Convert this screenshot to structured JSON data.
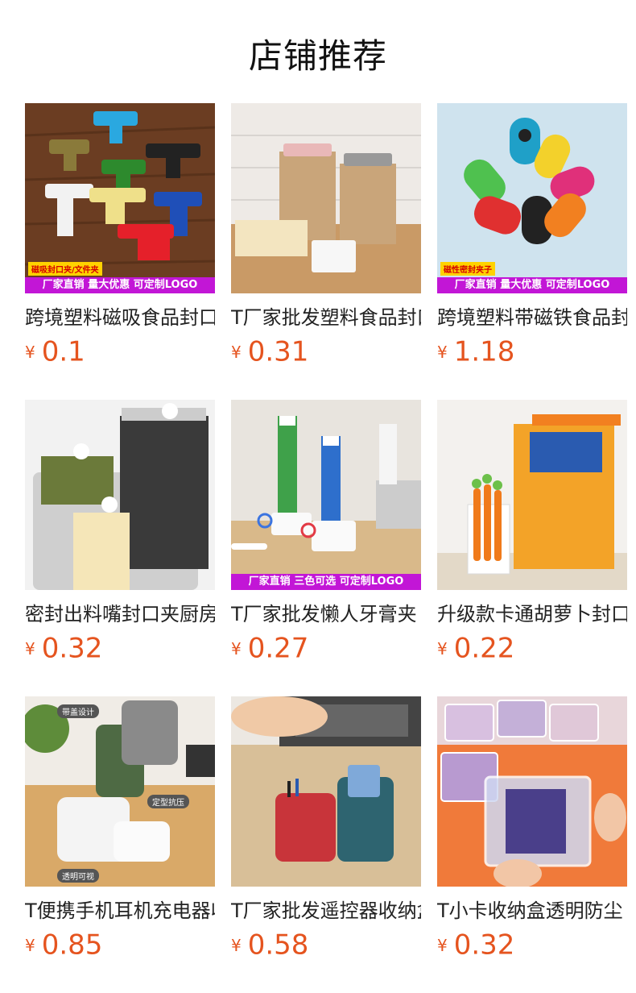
{
  "shop": {
    "title": "店铺推荐"
  },
  "currency": "¥",
  "products": [
    {
      "name": "跨境塑料磁吸食品封口夹",
      "price": "0.1",
      "banner": "厂家直销 量大优惠 可定制LOGO",
      "tag": "磁吸封口夹/文件夹"
    },
    {
      "name": "T厂家批发塑料食品封口夹",
      "price": "0.31",
      "banner": "",
      "tag": ""
    },
    {
      "name": "跨境塑料带磁铁食品封口夹",
      "price": "1.18",
      "banner": "厂家直销 量大优惠 可定制LOGO",
      "tag": "磁性密封夹子"
    },
    {
      "name": "密封出料嘴封口夹厨房",
      "price": "0.32",
      "banner": "",
      "tag": ""
    },
    {
      "name": "T厂家批发懒人牙膏夹",
      "price": "0.27",
      "banner": "厂家直销 三色可选 可定制LOGO",
      "tag": ""
    },
    {
      "name": "升级款卡通胡萝卜封口夹",
      "price": "0.22",
      "banner": "",
      "tag": ""
    },
    {
      "name": "T便携手机耳机充电器收纳盒",
      "price": "0.85",
      "banner": "",
      "tag": "",
      "labels": [
        "带盖设计",
        "定型抗压",
        "透明可视"
      ]
    },
    {
      "name": "T厂家批发遥控器收纳盒",
      "price": "0.58",
      "banner": "",
      "tag": ""
    },
    {
      "name": "T小卡收纳盒透明防尘",
      "price": "0.32",
      "banner": "",
      "tag": ""
    }
  ],
  "colors": {
    "price": "#e5541f",
    "banner": "#c216d6"
  }
}
